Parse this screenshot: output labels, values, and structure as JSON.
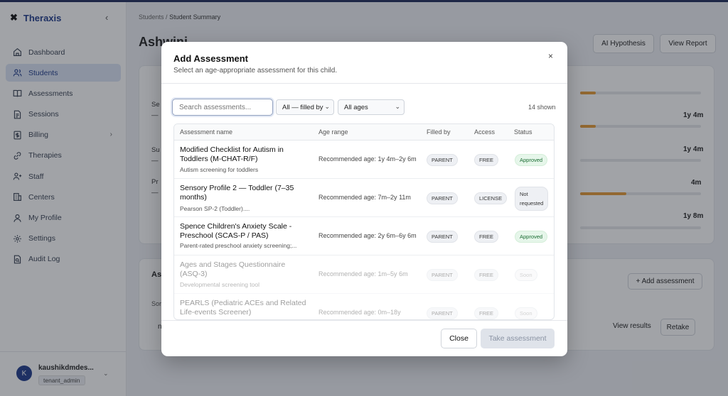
{
  "app": {
    "brand": "Theraxis",
    "logo_glyph": "✖",
    "collapse_glyph": "‹"
  },
  "sidebar": {
    "items": [
      {
        "label": "Dashboard",
        "icon": "home-icon"
      },
      {
        "label": "Students",
        "icon": "users-icon",
        "active": true
      },
      {
        "label": "Assessments",
        "icon": "book-icon"
      },
      {
        "label": "Sessions",
        "icon": "document-icon"
      },
      {
        "label": "Billing",
        "icon": "billing-icon",
        "has_children": true
      },
      {
        "label": "Therapies",
        "icon": "link-icon"
      },
      {
        "label": "Staff",
        "icon": "user-plus-icon"
      },
      {
        "label": "Centers",
        "icon": "building-icon"
      },
      {
        "label": "My Profile",
        "icon": "user-icon"
      },
      {
        "label": "Settings",
        "icon": "gear-icon"
      },
      {
        "label": "Audit Log",
        "icon": "log-icon"
      }
    ],
    "user": {
      "initial": "K",
      "name": "kaushikdmdes...",
      "role": "tenant_admin"
    }
  },
  "main": {
    "breadcrumb": {
      "parent": "Students",
      "separator": "/",
      "current": "Student Summary"
    },
    "student_name": "Ashwini",
    "header_buttons": {
      "ai_hypothesis": "AI Hypothesis",
      "view_report": "View Report"
    },
    "partial_labels": {
      "row1": "Se",
      "row2": "Su",
      "row3": "Pr",
      "dash": "—",
      "assess": "As",
      "sort": "Sor",
      "n": "n"
    },
    "values": [
      "1y 4m",
      "1y 4m",
      "4m",
      "1y 8m"
    ],
    "progress": [
      0.13,
      0.13,
      0.0,
      0.38
    ],
    "add_assessment": "+ Add assessment",
    "view_results": "View results",
    "retake": "Retake"
  },
  "modal": {
    "title": "Add Assessment",
    "subtitle": "Select an age-appropriate assessment for this child.",
    "close_glyph": "×",
    "search_placeholder": "Search assessments...",
    "filter_by": "All — filled by",
    "filter_age": "All ages",
    "shown": "14 shown",
    "columns": [
      "Assessment name",
      "Age range",
      "Filled by",
      "Access",
      "Status"
    ],
    "rows": [
      {
        "name": "Modified Checklist for Autism in Toddlers (M-CHAT-R/F)",
        "desc": "Autism screening for toddlers",
        "age": "Recommended age: 1y 4m–2y 6m",
        "filled_by": "PARENT",
        "access": "FREE",
        "status": "Approved"
      },
      {
        "name": "Sensory Profile 2 — Toddler (7–35 months)",
        "desc": "Pearson SP-2 (Toddler)....",
        "age": "Recommended age: 7m–2y 11m",
        "filled_by": "PARENT",
        "access": "LICENSE",
        "status_line1": "Not",
        "status_line2": "requested"
      },
      {
        "name": "Spence Children's Anxiety Scale - Preschool (SCAS-P / PAS)",
        "desc": "Parent-rated preschool anxiety screening;...",
        "age": "Recommended age: 2y 6m–6y 6m",
        "filled_by": "PARENT",
        "access": "FREE",
        "status": "Approved"
      },
      {
        "name": "Ages and Stages Questionnaire (ASQ-3)",
        "desc": "Developmental screening tool",
        "age": "Recommended age: 1m–5y 6m",
        "filled_by": "PARENT",
        "access": "FREE",
        "status": "Soon"
      },
      {
        "name": "PEARLS (Pediatric ACEs and Related Life-events Screener)",
        "desc": "",
        "age": "Recommended age: 0m–18y",
        "filled_by": "PARENT",
        "access": "FREE",
        "status": "Soon"
      }
    ],
    "btn_close": "Close",
    "btn_take": "Take assessment"
  }
}
